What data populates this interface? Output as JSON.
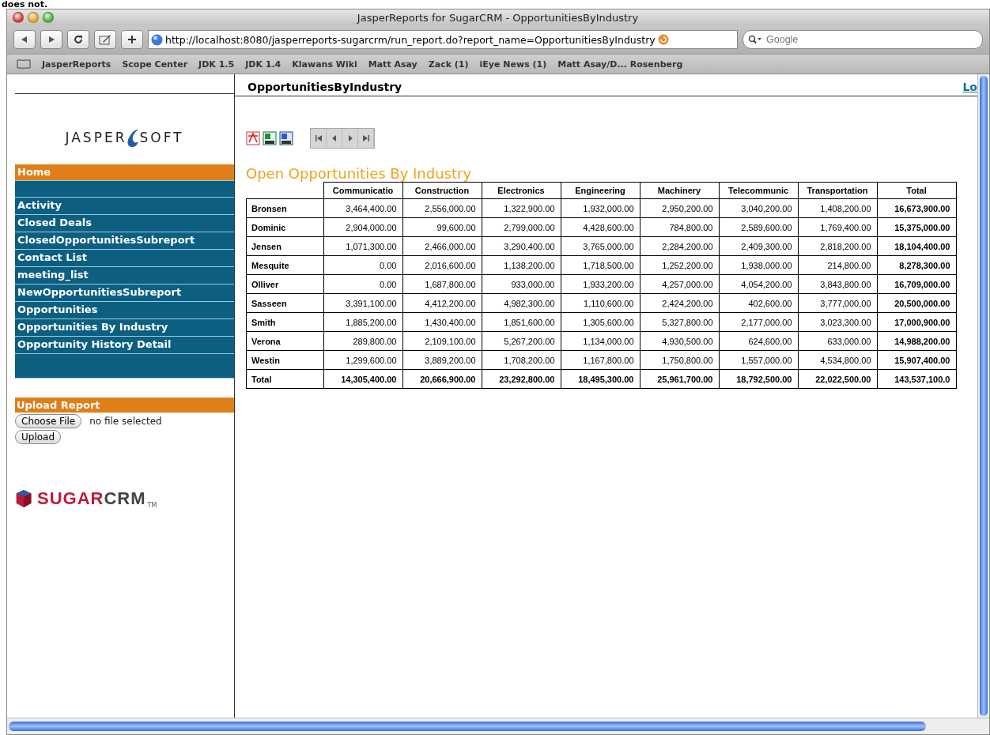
{
  "caption_fragment": "does not.",
  "window": {
    "title": "JasperReports for SugarCRM - OpportunitiesByIndustry"
  },
  "toolbar": {
    "url": "http://localhost:8080/jasperreports-sugarcrm/run_report.do?report_name=OpportunitiesByIndustry",
    "search": {
      "placeholder": "Google"
    }
  },
  "bookmarks": [
    "JasperReports",
    "Scope Center",
    "JDK 1.5",
    "JDK 1.4",
    "Klawans Wiki",
    "Matt Asay",
    "Zack (1)",
    "iEye News (1)",
    "Matt Asay/D... Rosenberg"
  ],
  "logos": {
    "jaspersoft": [
      "JASPER",
      "SOFT"
    ],
    "sugarcrm": [
      "SUGAR",
      "CRM",
      "TM"
    ]
  },
  "sidebar": {
    "home": "Home",
    "items": [
      {
        "label": "Activity",
        "selected": false
      },
      {
        "label": "Closed Deals",
        "selected": false
      },
      {
        "label": "ClosedOpportunitiesSubreport",
        "selected": false
      },
      {
        "label": "Contact List",
        "selected": false
      },
      {
        "label": "meeting_list",
        "selected": false
      },
      {
        "label": "NewOpportunitiesSubreport",
        "selected": false
      },
      {
        "label": "Opportunities",
        "selected": false
      },
      {
        "label": "Opportunities By Industry",
        "selected": false
      },
      {
        "label": "Opportunity History Detail",
        "selected": false
      }
    ],
    "upload": {
      "heading": "Upload Report",
      "choose_button": "Choose File",
      "file_status": "no file selected",
      "upload_button": "Upload"
    }
  },
  "header": {
    "report_name": "OpportunitiesByIndustry",
    "link": "Lo"
  },
  "report": {
    "title": "Open Opportunities By Industry",
    "columns": [
      "Communicatio",
      "Construction",
      "Electronics",
      "Engineering",
      "Machinery",
      "Telecommunic",
      "Transportation",
      "Total"
    ],
    "rows": [
      {
        "name": "Bronsen",
        "values": [
          "3,464,400.00",
          "2,556,000.00",
          "1,322,900.00",
          "1,932,000.00",
          "2,950,200.00",
          "3,040,200.00",
          "1,408,200.00",
          "16,673,900.00"
        ]
      },
      {
        "name": "Dominic",
        "values": [
          "2,904,000.00",
          "99,600.00",
          "2,799,000.00",
          "4,428,600.00",
          "784,800.00",
          "2,589,600.00",
          "1,769,400.00",
          "15,375,000.00"
        ]
      },
      {
        "name": "Jensen",
        "values": [
          "1,071,300.00",
          "2,466,000.00",
          "3,290,400.00",
          "3,765,000.00",
          "2,284,200.00",
          "2,409,300.00",
          "2,818,200.00",
          "18,104,400.00"
        ]
      },
      {
        "name": "Mesquite",
        "values": [
          "0.00",
          "2,016,600.00",
          "1,138,200.00",
          "1,718,500.00",
          "1,252,200.00",
          "1,938,000.00",
          "214,800.00",
          "8,278,300.00"
        ]
      },
      {
        "name": "Olliver",
        "values": [
          "0.00",
          "1,687,800.00",
          "933,000.00",
          "1,933,200.00",
          "4,257,000.00",
          "4,054,200.00",
          "3,843,800.00",
          "16,709,000.00"
        ]
      },
      {
        "name": "Sasseen",
        "values": [
          "3,391,100.00",
          "4,412,200.00",
          "4,982,300.00",
          "1,110,600.00",
          "2,424,200.00",
          "402,600.00",
          "3,777,000.00",
          "20,500,000.00"
        ]
      },
      {
        "name": "Smith",
        "values": [
          "1,885,200.00",
          "1,430,400.00",
          "1,851,600.00",
          "1,305,600.00",
          "5,327,800.00",
          "2,177,000.00",
          "3,023,300.00",
          "17,000,900.00"
        ]
      },
      {
        "name": "Verona",
        "values": [
          "289,800.00",
          "2,109,100.00",
          "5,267,200.00",
          "1,134,000.00",
          "4,930,500.00",
          "624,600.00",
          "633,000.00",
          "14,988,200.00"
        ]
      },
      {
        "name": "Westin",
        "values": [
          "1,299,600.00",
          "3,889,200.00",
          "1,708,200.00",
          "1,167,800.00",
          "1,750,800.00",
          "1,557,000.00",
          "4,534,800.00",
          "15,907,400.00"
        ]
      },
      {
        "name": "Total",
        "kind": "total",
        "values": [
          "14,305,400.00",
          "20,666,900.00",
          "23,292,800.00",
          "18,495,300.00",
          "25,961,700.00",
          "18,792,500.00",
          "22,022,500.00",
          "143,537,100.0"
        ]
      }
    ]
  }
}
